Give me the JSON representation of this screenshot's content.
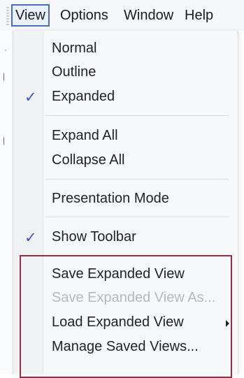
{
  "menubar": {
    "items": [
      "View",
      "Options",
      "Window",
      "Help"
    ]
  },
  "dropdown": {
    "items": [
      {
        "label": "Normal",
        "checked": false,
        "disabled": false
      },
      {
        "label": "Outline",
        "checked": false,
        "disabled": false
      },
      {
        "label": "Expanded",
        "checked": true,
        "disabled": false
      },
      {
        "label": "Expand All",
        "checked": false,
        "disabled": false
      },
      {
        "label": "Collapse All",
        "checked": false,
        "disabled": false
      },
      {
        "label": "Presentation Mode",
        "checked": false,
        "disabled": false
      },
      {
        "label": "Show Toolbar",
        "checked": true,
        "disabled": false
      },
      {
        "label": "Save Expanded View",
        "checked": false,
        "disabled": false
      },
      {
        "label": "Save Expanded View As...",
        "checked": false,
        "disabled": true
      },
      {
        "label": "Load Expanded View",
        "checked": false,
        "disabled": false,
        "has_submenu": true
      },
      {
        "label": "Manage Saved Views...",
        "checked": false,
        "disabled": false
      }
    ],
    "check_glyph": "✓"
  },
  "colors": {
    "check": "#3e55c2",
    "highlight_border": "#9b2c45",
    "active_menu_border": "#4a6fb7"
  }
}
